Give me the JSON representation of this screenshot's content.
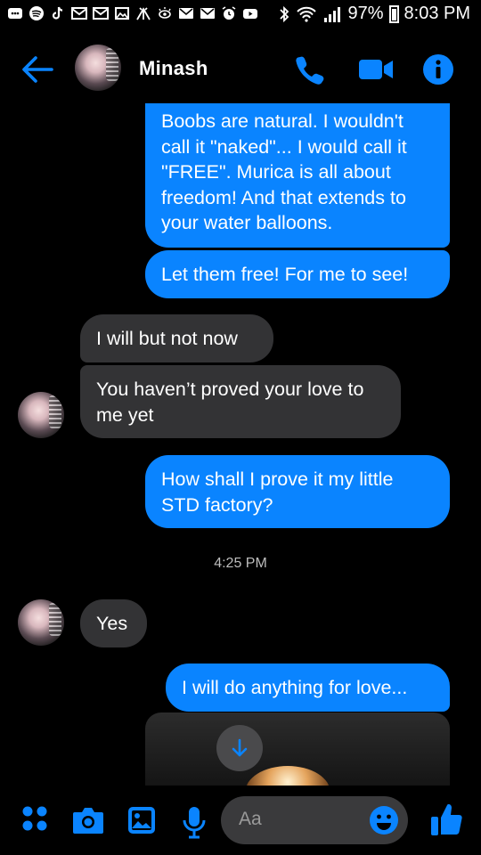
{
  "status_bar": {
    "battery": "97%",
    "time": "8:03 PM",
    "icons": [
      "messages-icon",
      "spotify-icon",
      "tiktok-icon",
      "gmail-icon",
      "gmail-icon",
      "gallery-icon",
      "tent-icon",
      "eye-icon",
      "email-icon",
      "email-icon",
      "alarm-icon",
      "youtube-icon",
      "bluetooth-icon",
      "wifi-icon",
      "signal-icon",
      "battery-icon"
    ]
  },
  "header": {
    "contact_name": "Minash",
    "icons": [
      "back-arrow-icon",
      "phone-icon",
      "video-camera-icon",
      "info-icon"
    ]
  },
  "messages": [
    {
      "from": "me",
      "text": "Boobs are natural. I wouldn't call it \"naked\"... I would call it \"FREE\". Murica is all about freedom! And that extends to your water balloons."
    },
    {
      "from": "me",
      "text": "Let them free! For me to see!"
    },
    {
      "from": "them",
      "text": "I will but not now"
    },
    {
      "from": "them",
      "text": "You haven’t proved your love to me yet"
    },
    {
      "from": "me",
      "text": "How shall I prove it my little STD factory?"
    },
    {
      "from": "timestamp",
      "text": "4:25 PM"
    },
    {
      "from": "them",
      "text": "Yes"
    },
    {
      "from": "me",
      "text": "I will do anything for love..."
    }
  ],
  "composer": {
    "placeholder": "Aa",
    "icons": [
      "menu-dots-icon",
      "camera-icon",
      "image-icon",
      "microphone-icon",
      "emoji-icon",
      "thumbs-up-icon"
    ]
  },
  "colors": {
    "accent": "#0a84ff",
    "outgoing_bubble": "#0a84ff",
    "incoming_bubble": "#333335",
    "background": "#000000"
  }
}
